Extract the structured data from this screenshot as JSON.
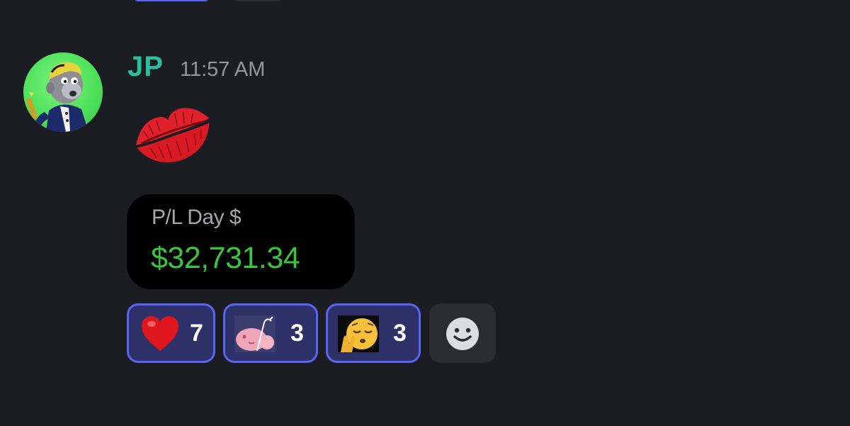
{
  "message": {
    "author": "JP",
    "timestamp": "11:57 AM",
    "author_color": "#2bbf9c",
    "content_emoji": "kiss-mark-lips",
    "embed": {
      "label": "P/L Day $",
      "value": "$32,731.34",
      "value_color": "#3cc23e",
      "background": "#000000"
    }
  },
  "reactions": [
    {
      "emoji": "red-heart",
      "count": "7",
      "active": true
    },
    {
      "emoji": "pink-creature-custom-emoji",
      "count": "3",
      "active": true
    },
    {
      "emoji": "pensive-kiss-face-custom-emoji",
      "count": "3",
      "active": true
    }
  ],
  "add_reaction": {
    "icon": "smiley-face-icon"
  },
  "colors": {
    "background": "#1c1d22",
    "reaction_active_bg": "#2e3167",
    "reaction_active_border": "#5865f2",
    "timestamp": "#9496a0"
  }
}
